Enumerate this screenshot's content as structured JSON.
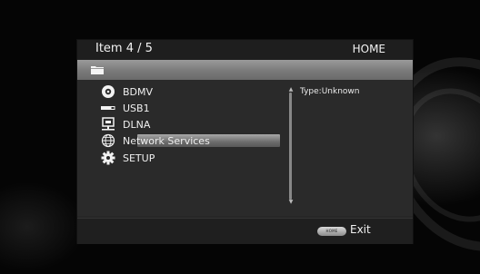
{
  "header": {
    "item_count": "Item  4 / 5",
    "mode_title": "HOME"
  },
  "pathbar": {
    "icon": "folder-icon"
  },
  "menu": {
    "items": [
      {
        "label": "BDMV",
        "icon": "disc-icon"
      },
      {
        "label": "USB1",
        "icon": "usb-icon"
      },
      {
        "label": "DLNA",
        "icon": "dlna-icon"
      },
      {
        "label": "Network Services",
        "icon": "globe-icon",
        "selected": true
      },
      {
        "label": "SETUP",
        "icon": "gear-icon"
      }
    ]
  },
  "info": {
    "type_text": "Type:Unknown"
  },
  "footer": {
    "home_key_label": "HOME",
    "exit_label": "Exit"
  },
  "colors": {
    "panel_bg": "#262626",
    "pathbar": "#8a8a8a",
    "selection": "#8a8a8a",
    "text": "#efefef"
  }
}
